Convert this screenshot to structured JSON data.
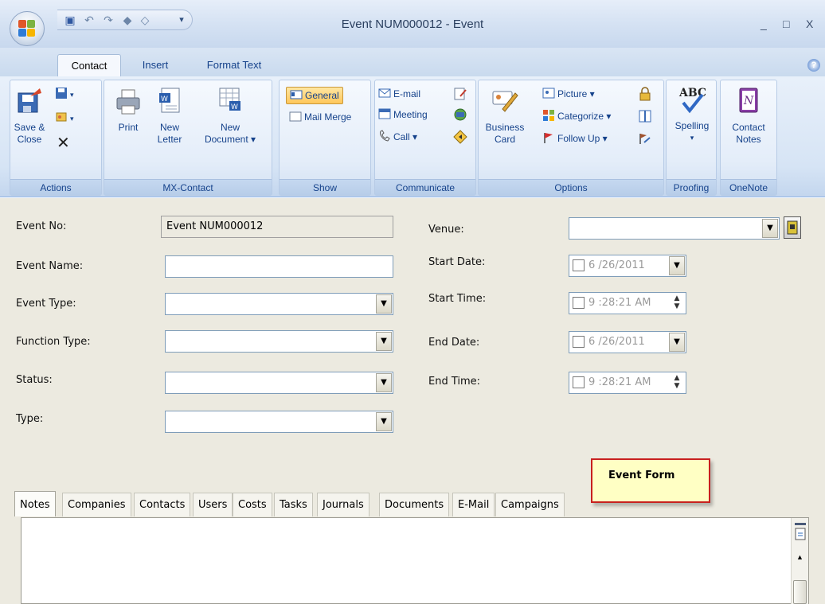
{
  "window": {
    "title": "Event NUM000012 - Event",
    "minimize": "_",
    "maximize": "□",
    "close": "X"
  },
  "tabs": [
    {
      "label": "Contact",
      "active": true
    },
    {
      "label": "Insert",
      "active": false
    },
    {
      "label": "Format Text",
      "active": false
    }
  ],
  "help_glyph": "?",
  "ribbon": {
    "actions": {
      "label": "Actions",
      "save_close": "Save &",
      "save_close_2": "Close",
      "delete_glyph": "✕"
    },
    "mxcontact": {
      "label": "MX-Contact",
      "print": "Print",
      "new_letter": "New",
      "new_letter_2": "Letter",
      "new_document": "New",
      "new_document_2": "Document ▾"
    },
    "show": {
      "label": "Show",
      "general": "General",
      "mail_merge": "Mail Merge"
    },
    "communicate": {
      "label": "Communicate",
      "email": "E-mail",
      "meeting": "Meeting",
      "call": "Call ▾"
    },
    "options": {
      "label": "Options",
      "business_card": "Business",
      "business_card_2": "Card",
      "picture": "Picture ▾",
      "categorize": "Categorize ▾",
      "follow_up": "Follow Up ▾"
    },
    "proofing": {
      "label": "Proofing",
      "spelling": "Spelling",
      "spelling_2": "▾",
      "abc": "ABC"
    },
    "onenote": {
      "label": "OneNote",
      "contact_notes": "Contact",
      "contact_notes_2": "Notes"
    }
  },
  "form": {
    "event_no_label": "Event No:",
    "event_no_value": "Event NUM000012",
    "event_name_label": "Event Name:",
    "event_name_value": "",
    "event_type_label": "Event Type:",
    "function_type_label": "Function Type:",
    "status_label": "Status:",
    "type_label": "Type:",
    "venue_label": "Venue:",
    "start_date_label": "Start Date:",
    "start_date_value": "6 /26/2011",
    "start_time_label": "Start Time:",
    "start_time_value": "9 :28:21 AM",
    "end_date_label": "End Date:",
    "end_date_value": "6 /26/2011",
    "end_time_label": "End Time:",
    "end_time_value": "9 :28:21 AM",
    "dropdown_glyph": "▼"
  },
  "callout": "Event Form",
  "bottom_tabs": [
    "Notes",
    "Companies",
    "Contacts",
    "Users",
    "Costs",
    "Tasks",
    "Journals",
    "Documents",
    "E-Mail",
    "Campaigns"
  ],
  "scroll_up": "▲"
}
